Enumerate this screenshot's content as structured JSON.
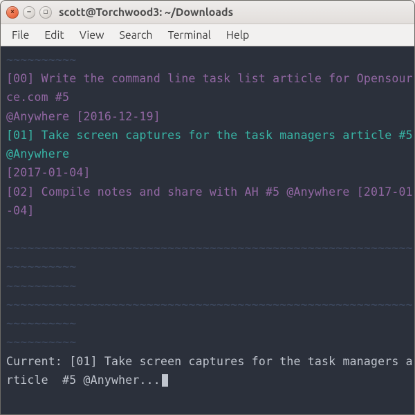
{
  "titlebar": {
    "title": "scott@Torchwood3: ~/Downloads"
  },
  "menubar": {
    "items": [
      "File",
      "Edit",
      "View",
      "Search",
      "Terminal",
      "Help"
    ]
  },
  "terminal": {
    "sep_short": "~~~~~~~~~~",
    "sep_long": "~~~~~~~~~~~~~~~~~~~~~~~~~~~~~~~~~~~~~~~~~~~~~~~~~~~~~~~~~~~~~~~~~~~~",
    "tasks": [
      {
        "idx_label": "[00]",
        "text": " Write the command line task list article for Opensource.com #5",
        "meta": "@Anywhere [2016-12-19]"
      },
      {
        "idx_label": "[01]",
        "text": " Take screen captures for the task managers article #5 @Anywhere",
        "meta": "[2017-01-04]"
      },
      {
        "idx_label": "[02]",
        "text": " Compile notes and share with AH #5 @Anywhere [2017-01-04]",
        "meta": ""
      }
    ],
    "current_label": "Current: ",
    "current_idx": "[01]",
    "current_text": " Take screen captures for the task managers article  #5 @Anywher..."
  }
}
